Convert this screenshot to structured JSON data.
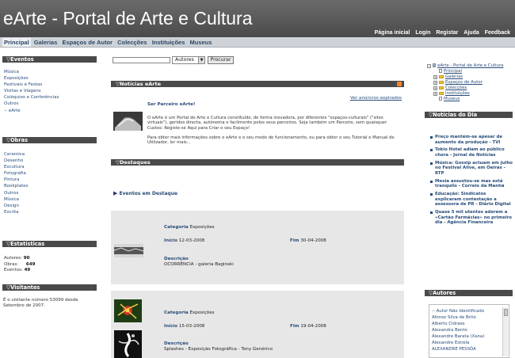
{
  "header": {
    "title": "eArte - Portal de Arte e Cultura",
    "links": [
      "Página inicial",
      "Login",
      "Registar",
      "Ajuda",
      "Feedback"
    ]
  },
  "nav": {
    "tabs": [
      "Principal",
      "Galerias",
      "Espaços de Autor",
      "Colecções",
      "Instituições",
      "Museus"
    ],
    "active": "Principal"
  },
  "sidebar_left": {
    "eventos": {
      "title": "Eventos",
      "items": [
        "Música",
        "Exposições",
        "Festivais e Festas",
        "Visitas e Viagens",
        "Colóquios e Conferências",
        "Outros",
        "-- eArte"
      ]
    },
    "obras": {
      "title": "Obras",
      "items": [
        "Ceramica",
        "Desenho",
        "Escultura",
        "Fotografia",
        "Pintura",
        "Bookplates",
        "Outros",
        "Música",
        "Design",
        "Escrita"
      ]
    },
    "estatisticas": {
      "title": "Estatísticas",
      "rows": [
        {
          "label": "Autores:",
          "value": "90"
        },
        {
          "label": "Obras:",
          "value": "649"
        },
        {
          "label": "Eventos:",
          "value": "49"
        }
      ]
    },
    "visitantes": {
      "title": "Visitantes",
      "text": "É o visitante número 53099 desde Setembro de 2007."
    }
  },
  "search": {
    "value": "",
    "select_value": "Autores",
    "button": "Procurar"
  },
  "noticias": {
    "title": "Notícias eArte",
    "ver_link": "Ver anúncios expirados",
    "headline": "Ser Parceiro eArte!",
    "body1": "O eArte é um Portal de Arte e Cultura constituído, de forma inovadora, por diferentes \"espaços-culturais\" (\"sites virtuais\"), geridos directa, autónoma e facilmente pelos seus parceiros. Seja também um Parceiro, sem quaisquer Custos: Registe-se Aqui para Criar o seu Espaço!",
    "body2": "Para obter mais informações sobre o eArte e o seu modo de funcionamento, ou para obter o seu Tutorial e Manual de Utilizador, ler mais..."
  },
  "destaques": {
    "title": "Destaques",
    "subtitle": "Eventos em Destaque",
    "events": [
      {
        "categoria_label": "Categoria",
        "categoria": "Exposições",
        "inicio_label": "Início",
        "inicio": "12-03-2008",
        "fim_label": "Fim",
        "fim": "30-04-2008",
        "descricao_label": "Descrição",
        "descricao": "OCORRÊNCIA - galeria Baginski"
      },
      {
        "categoria_label": "Categoria",
        "categoria": "Exposições",
        "inicio_label": "Início",
        "inicio": "15-03-2008",
        "fim_label": "Fim",
        "fim": "19-04-2008",
        "descricao_label": "Descrição",
        "descricao": "Splashes - Exposição Fotográfica - Tony Genérico"
      }
    ]
  },
  "sidebar_right": {
    "tree": {
      "root": "eArte - Portal de Arte e Cultura",
      "items": [
        "Principal",
        "Galerias",
        "Espaços de Autor",
        "Colecções",
        "Instituições",
        "Museus"
      ]
    },
    "noticias_dia": {
      "title": "Notícias do Dia",
      "items": [
        "Preço mantém-se apesar de aumento da produção - TVI",
        "Tokio Hotel adiam ao público chora - Jornal de Notícias",
        "Música: Gossip actuam em Julho no Festival Alive, em Oeiras - RTP",
        "Mexia assustou-se mas está tranquilo - Correio da Manhã",
        "Educação: Sindicatos explicaram contestação a assessora de PR - Diário Digital",
        "Quase 5 mil utentes aderem a «Cartão Farmácias» no primeiro dia - Agência Financeira"
      ]
    },
    "autores": {
      "title": "Autores",
      "items": [
        "-- Autor Não Identificado",
        "Afonso Silva de Brito",
        "Alberto Cidraes",
        "Alexandra Bento",
        "Alexandre Barata (Xana)",
        "Alexandre Estrela",
        "ALEXANDRE PESSÔA"
      ]
    }
  },
  "colors": {
    "header_bg": "#555555",
    "section_bar": "#4a4a4a",
    "nav_bg": "#cfd3d8",
    "link": "#284c7a",
    "card_bg": "#e7e7e7",
    "rss": "#f2852e"
  }
}
